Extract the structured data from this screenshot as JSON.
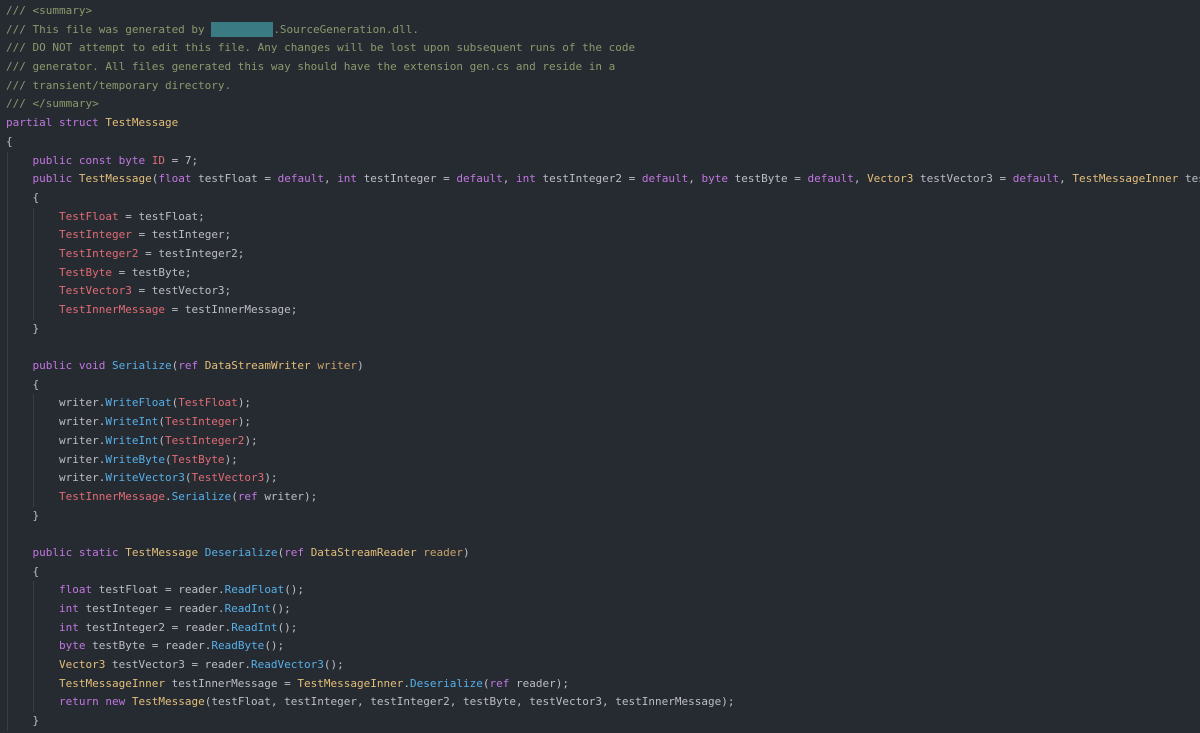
{
  "colors": {
    "background": "#262a31",
    "comment": "#8a9a6c",
    "keyword": "#c077e0",
    "type": "#e3bf7a",
    "field": "#e06c75",
    "method": "#56b0e8",
    "param": "#c9a36b",
    "plain": "#bcbec4",
    "redacted": "#3a7b83"
  },
  "lines": [
    {
      "guides": 0,
      "tokens": [
        {
          "k": "comment",
          "t": "/// <summary>"
        }
      ]
    },
    {
      "guides": 0,
      "tokens": [
        {
          "k": "comment",
          "t": "/// This file was generated by "
        },
        {
          "k": "redacted",
          "t": ""
        },
        {
          "k": "comment",
          "t": ".SourceGeneration.dll."
        }
      ]
    },
    {
      "guides": 0,
      "tokens": [
        {
          "k": "comment",
          "t": "/// DO NOT attempt to edit this file. Any changes will be lost upon subsequent runs of the code"
        }
      ]
    },
    {
      "guides": 0,
      "tokens": [
        {
          "k": "comment",
          "t": "/// generator. All files generated this way should have the extension gen.cs and reside in a"
        }
      ]
    },
    {
      "guides": 0,
      "tokens": [
        {
          "k": "comment",
          "t": "/// transient/temporary directory."
        }
      ]
    },
    {
      "guides": 0,
      "tokens": [
        {
          "k": "comment",
          "t": "/// </summary>"
        }
      ]
    },
    {
      "guides": 0,
      "tokens": [
        {
          "k": "keyword",
          "t": "partial struct "
        },
        {
          "k": "type",
          "t": "TestMessage"
        }
      ]
    },
    {
      "guides": 0,
      "tokens": [
        {
          "k": "plain",
          "t": "{"
        }
      ]
    },
    {
      "guides": 1,
      "tokens": [
        {
          "k": "plain",
          "t": "    "
        },
        {
          "k": "keyword",
          "t": "public const byte "
        },
        {
          "k": "field",
          "t": "ID"
        },
        {
          "k": "plain",
          "t": " = 7;"
        }
      ]
    },
    {
      "guides": 1,
      "tokens": [
        {
          "k": "plain",
          "t": "    "
        },
        {
          "k": "keyword",
          "t": "public "
        },
        {
          "k": "type",
          "t": "TestMessage"
        },
        {
          "k": "plain",
          "t": "("
        },
        {
          "k": "keyword",
          "t": "float "
        },
        {
          "k": "plain",
          "t": "testFloat = "
        },
        {
          "k": "keyword",
          "t": "default"
        },
        {
          "k": "plain",
          "t": ", "
        },
        {
          "k": "keyword",
          "t": "int "
        },
        {
          "k": "plain",
          "t": "testInteger = "
        },
        {
          "k": "keyword",
          "t": "default"
        },
        {
          "k": "plain",
          "t": ", "
        },
        {
          "k": "keyword",
          "t": "int "
        },
        {
          "k": "plain",
          "t": "testInteger2 = "
        },
        {
          "k": "keyword",
          "t": "default"
        },
        {
          "k": "plain",
          "t": ", "
        },
        {
          "k": "keyword",
          "t": "byte "
        },
        {
          "k": "plain",
          "t": "testByte = "
        },
        {
          "k": "keyword",
          "t": "default"
        },
        {
          "k": "plain",
          "t": ", "
        },
        {
          "k": "type",
          "t": "Vector3 "
        },
        {
          "k": "plain",
          "t": "testVector3 = "
        },
        {
          "k": "keyword",
          "t": "default"
        },
        {
          "k": "plain",
          "t": ", "
        },
        {
          "k": "type",
          "t": "TestMessageInner "
        },
        {
          "k": "plain",
          "t": "testI"
        }
      ]
    },
    {
      "guides": 1,
      "tokens": [
        {
          "k": "plain",
          "t": "    {"
        }
      ]
    },
    {
      "guides": 2,
      "tokens": [
        {
          "k": "plain",
          "t": "        "
        },
        {
          "k": "field",
          "t": "TestFloat"
        },
        {
          "k": "plain",
          "t": " = testFloat;"
        }
      ]
    },
    {
      "guides": 2,
      "tokens": [
        {
          "k": "plain",
          "t": "        "
        },
        {
          "k": "field",
          "t": "TestInteger"
        },
        {
          "k": "plain",
          "t": " = testInteger;"
        }
      ]
    },
    {
      "guides": 2,
      "tokens": [
        {
          "k": "plain",
          "t": "        "
        },
        {
          "k": "field",
          "t": "TestInteger2"
        },
        {
          "k": "plain",
          "t": " = testInteger2;"
        }
      ]
    },
    {
      "guides": 2,
      "tokens": [
        {
          "k": "plain",
          "t": "        "
        },
        {
          "k": "field",
          "t": "TestByte"
        },
        {
          "k": "plain",
          "t": " = testByte;"
        }
      ]
    },
    {
      "guides": 2,
      "tokens": [
        {
          "k": "plain",
          "t": "        "
        },
        {
          "k": "field",
          "t": "TestVector3"
        },
        {
          "k": "plain",
          "t": " = testVector3;"
        }
      ]
    },
    {
      "guides": 2,
      "tokens": [
        {
          "k": "plain",
          "t": "        "
        },
        {
          "k": "field",
          "t": "TestInnerMessage"
        },
        {
          "k": "plain",
          "t": " = testInnerMessage;"
        }
      ]
    },
    {
      "guides": 1,
      "tokens": [
        {
          "k": "plain",
          "t": "    }"
        }
      ]
    },
    {
      "guides": 1,
      "tokens": []
    },
    {
      "guides": 1,
      "tokens": [
        {
          "k": "plain",
          "t": "    "
        },
        {
          "k": "keyword",
          "t": "public void "
        },
        {
          "k": "method",
          "t": "Serialize"
        },
        {
          "k": "plain",
          "t": "("
        },
        {
          "k": "keyword",
          "t": "ref "
        },
        {
          "k": "type",
          "t": "DataStreamWriter "
        },
        {
          "k": "param",
          "t": "writer"
        },
        {
          "k": "plain",
          "t": ")"
        }
      ]
    },
    {
      "guides": 1,
      "tokens": [
        {
          "k": "plain",
          "t": "    {"
        }
      ]
    },
    {
      "guides": 2,
      "tokens": [
        {
          "k": "plain",
          "t": "        writer."
        },
        {
          "k": "method",
          "t": "WriteFloat"
        },
        {
          "k": "plain",
          "t": "("
        },
        {
          "k": "field",
          "t": "TestFloat"
        },
        {
          "k": "plain",
          "t": ");"
        }
      ]
    },
    {
      "guides": 2,
      "tokens": [
        {
          "k": "plain",
          "t": "        writer."
        },
        {
          "k": "method",
          "t": "WriteInt"
        },
        {
          "k": "plain",
          "t": "("
        },
        {
          "k": "field",
          "t": "TestInteger"
        },
        {
          "k": "plain",
          "t": ");"
        }
      ]
    },
    {
      "guides": 2,
      "tokens": [
        {
          "k": "plain",
          "t": "        writer."
        },
        {
          "k": "method",
          "t": "WriteInt"
        },
        {
          "k": "plain",
          "t": "("
        },
        {
          "k": "field",
          "t": "TestInteger2"
        },
        {
          "k": "plain",
          "t": ");"
        }
      ]
    },
    {
      "guides": 2,
      "tokens": [
        {
          "k": "plain",
          "t": "        writer."
        },
        {
          "k": "method",
          "t": "WriteByte"
        },
        {
          "k": "plain",
          "t": "("
        },
        {
          "k": "field",
          "t": "TestByte"
        },
        {
          "k": "plain",
          "t": ");"
        }
      ]
    },
    {
      "guides": 2,
      "tokens": [
        {
          "k": "plain",
          "t": "        writer."
        },
        {
          "k": "method",
          "t": "WriteVector3"
        },
        {
          "k": "plain",
          "t": "("
        },
        {
          "k": "field",
          "t": "TestVector3"
        },
        {
          "k": "plain",
          "t": ");"
        }
      ]
    },
    {
      "guides": 2,
      "tokens": [
        {
          "k": "plain",
          "t": "        "
        },
        {
          "k": "field",
          "t": "TestInnerMessage"
        },
        {
          "k": "plain",
          "t": "."
        },
        {
          "k": "method",
          "t": "Serialize"
        },
        {
          "k": "plain",
          "t": "("
        },
        {
          "k": "keyword",
          "t": "ref "
        },
        {
          "k": "plain",
          "t": "writer);"
        }
      ]
    },
    {
      "guides": 1,
      "tokens": [
        {
          "k": "plain",
          "t": "    }"
        }
      ]
    },
    {
      "guides": 1,
      "tokens": []
    },
    {
      "guides": 1,
      "tokens": [
        {
          "k": "plain",
          "t": "    "
        },
        {
          "k": "keyword",
          "t": "public static "
        },
        {
          "k": "type",
          "t": "TestMessage "
        },
        {
          "k": "method",
          "t": "Deserialize"
        },
        {
          "k": "plain",
          "t": "("
        },
        {
          "k": "keyword",
          "t": "ref "
        },
        {
          "k": "type",
          "t": "DataStreamReader "
        },
        {
          "k": "param",
          "t": "reader"
        },
        {
          "k": "plain",
          "t": ")"
        }
      ]
    },
    {
      "guides": 1,
      "tokens": [
        {
          "k": "plain",
          "t": "    {"
        }
      ]
    },
    {
      "guides": 2,
      "tokens": [
        {
          "k": "plain",
          "t": "        "
        },
        {
          "k": "keyword",
          "t": "float "
        },
        {
          "k": "plain",
          "t": "testFloat = reader."
        },
        {
          "k": "method",
          "t": "ReadFloat"
        },
        {
          "k": "plain",
          "t": "();"
        }
      ]
    },
    {
      "guides": 2,
      "tokens": [
        {
          "k": "plain",
          "t": "        "
        },
        {
          "k": "keyword",
          "t": "int "
        },
        {
          "k": "plain",
          "t": "testInteger = reader."
        },
        {
          "k": "method",
          "t": "ReadInt"
        },
        {
          "k": "plain",
          "t": "();"
        }
      ]
    },
    {
      "guides": 2,
      "tokens": [
        {
          "k": "plain",
          "t": "        "
        },
        {
          "k": "keyword",
          "t": "int "
        },
        {
          "k": "plain",
          "t": "testInteger2 = reader."
        },
        {
          "k": "method",
          "t": "ReadInt"
        },
        {
          "k": "plain",
          "t": "();"
        }
      ]
    },
    {
      "guides": 2,
      "tokens": [
        {
          "k": "plain",
          "t": "        "
        },
        {
          "k": "keyword",
          "t": "byte "
        },
        {
          "k": "plain",
          "t": "testByte = reader."
        },
        {
          "k": "method",
          "t": "ReadByte"
        },
        {
          "k": "plain",
          "t": "();"
        }
      ]
    },
    {
      "guides": 2,
      "tokens": [
        {
          "k": "plain",
          "t": "        "
        },
        {
          "k": "type",
          "t": "Vector3 "
        },
        {
          "k": "plain",
          "t": "testVector3 = reader."
        },
        {
          "k": "method",
          "t": "ReadVector3"
        },
        {
          "k": "plain",
          "t": "();"
        }
      ]
    },
    {
      "guides": 2,
      "tokens": [
        {
          "k": "plain",
          "t": "        "
        },
        {
          "k": "type",
          "t": "TestMessageInner "
        },
        {
          "k": "plain",
          "t": "testInnerMessage = "
        },
        {
          "k": "type",
          "t": "TestMessageInner"
        },
        {
          "k": "plain",
          "t": "."
        },
        {
          "k": "method",
          "t": "Deserialize"
        },
        {
          "k": "plain",
          "t": "("
        },
        {
          "k": "keyword",
          "t": "ref "
        },
        {
          "k": "plain",
          "t": "reader);"
        }
      ]
    },
    {
      "guides": 2,
      "tokens": [
        {
          "k": "plain",
          "t": "        "
        },
        {
          "k": "keyword",
          "t": "return new "
        },
        {
          "k": "type",
          "t": "TestMessage"
        },
        {
          "k": "plain",
          "t": "(testFloat, testInteger, testInteger2, testByte, testVector3, testInnerMessage);"
        }
      ]
    },
    {
      "guides": 1,
      "tokens": [
        {
          "k": "plain",
          "t": "    }"
        }
      ]
    }
  ]
}
